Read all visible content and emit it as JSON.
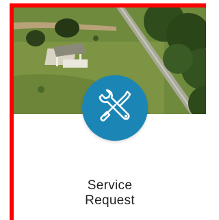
{
  "card": {
    "title_line1": "Service",
    "title_line2": "Request",
    "icon": "wrench-and-screwdriver-icon",
    "accent_color": "#1b86b5",
    "border_color": "#ff0000"
  }
}
